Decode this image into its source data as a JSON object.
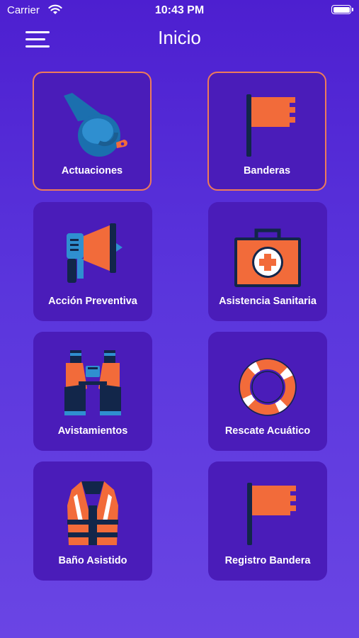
{
  "status_bar": {
    "carrier": "Carrier",
    "time": "10:43 PM"
  },
  "header": {
    "title": "Inicio"
  },
  "tiles": [
    {
      "label": "Actuaciones",
      "icon": "whistle-icon"
    },
    {
      "label": "Banderas",
      "icon": "flag-icon"
    },
    {
      "label": "Acción Preventiva",
      "icon": "megaphone-icon"
    },
    {
      "label": "Asistencia Sanitaria",
      "icon": "first-aid-kit-icon"
    },
    {
      "label": "Avistamientos",
      "icon": "binoculars-icon"
    },
    {
      "label": "Rescate Acuático",
      "icon": "lifebuoy-icon"
    },
    {
      "label": "Baño Asistido",
      "icon": "life-vest-icon"
    },
    {
      "label": "Registro Bandera",
      "icon": "flag-icon"
    }
  ],
  "colors": {
    "accent": "#f26b3a",
    "tile": "#4a1cb9",
    "background": "#5a35dc"
  }
}
